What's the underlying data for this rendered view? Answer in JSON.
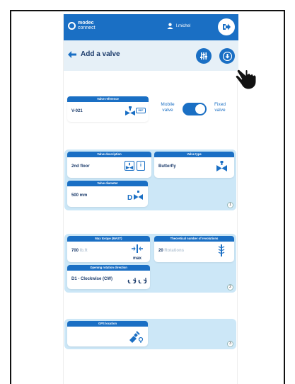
{
  "header": {
    "brand_line1": "modec",
    "brand_line2": "connect",
    "user_name": "l.michel"
  },
  "subheader": {
    "title": "Add a valve"
  },
  "valve_reference": {
    "label": "Valve reference",
    "value": "V-021",
    "badge": "REF"
  },
  "toggle": {
    "left_line1": "Mobile",
    "left_line2": "valve",
    "right_line1": "Fixed",
    "right_line2": "valve",
    "state": "fixed"
  },
  "section1": {
    "number": "1",
    "valve_description": {
      "label": "Valve description",
      "value": "2nd floor"
    },
    "valve_type": {
      "label": "Valve type",
      "value": "Butterfly"
    },
    "valve_diameter": {
      "label": "Valve diameter",
      "value": "500 mm"
    }
  },
  "section2": {
    "number": "2",
    "max_torque": {
      "label": "Max torque (MAST)",
      "value": "700",
      "unit": "lb.ft",
      "icon_text": "max"
    },
    "revolutions": {
      "label": "Theoretical number of revolutions",
      "value": "20",
      "unit": "Rotations"
    },
    "rotation": {
      "label": "Opening rotation direction",
      "value": "D1 - Clockwise (CW)"
    }
  },
  "section3": {
    "number": "3",
    "gps": {
      "label": "GPS location"
    }
  },
  "colors": {
    "primary": "#1a6fc4",
    "section_bg": "#cce7f7",
    "subbar_bg": "#e6f0f7",
    "text_dark": "#1b3b6b"
  }
}
